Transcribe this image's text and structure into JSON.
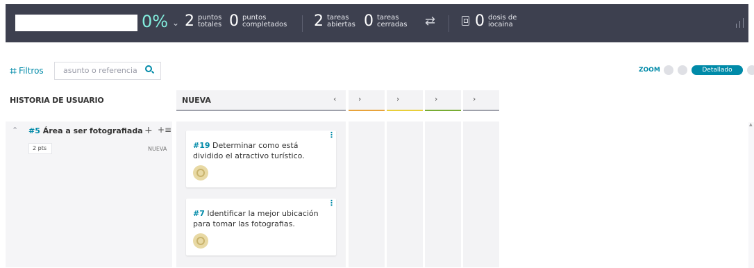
{
  "colors": {
    "bar": "#3d404f",
    "accent": "#008aa8",
    "percent": "#83eede",
    "col_orange": "#e8a33b",
    "col_yellow": "#e9cf3a",
    "col_green": "#78ac34",
    "col_gray": "#9fa1ab"
  },
  "stats": {
    "percent": "0%",
    "chevron_icon": "chevron-down-icon",
    "points_total": {
      "value": "2",
      "label": "puntos\ntotales"
    },
    "points_done": {
      "value": "0",
      "label": "puntos\ncompletados"
    },
    "tasks_open": {
      "value": "2",
      "label": "tareas\nabiertas"
    },
    "tasks_closed": {
      "value": "0",
      "label": "tareas\ncerradas"
    },
    "iocaine": {
      "value": "0",
      "label": "dosis de\niocaina"
    }
  },
  "filters": {
    "label": "Filtros",
    "search_placeholder": "asunto o referencia"
  },
  "zoom": {
    "label": "ZOOM",
    "selected": "Detallado"
  },
  "board": {
    "story_header": "HISTORIA DE USUARIO",
    "new_column": "NUEVA",
    "story": {
      "ref": "#5",
      "title": "Área a ser fotografiada",
      "points": "2 pts",
      "status": "NUEVA"
    },
    "cards": [
      {
        "ref": "#19",
        "text": "Determinar como está dividido el atractivo turístico."
      },
      {
        "ref": "#7",
        "text": "Identificar la mejor ubicación para tomar las fotografias."
      }
    ]
  }
}
